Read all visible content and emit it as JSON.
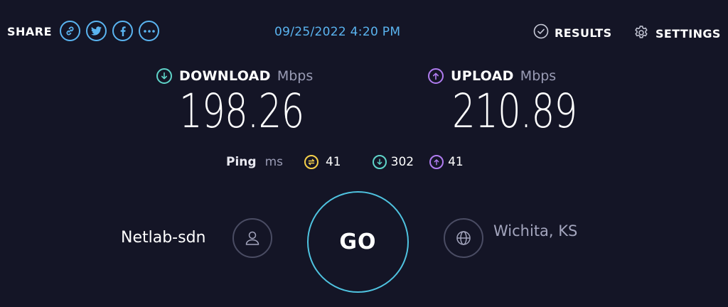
{
  "header": {
    "share_label": "SHARE",
    "share_icons": [
      "link-icon",
      "twitter-icon",
      "facebook-icon",
      "more-icon"
    ],
    "timestamp": "09/25/2022 4:20 PM",
    "results_label": "RESULTS",
    "settings_label": "SETTINGS"
  },
  "download": {
    "label": "DOWNLOAD",
    "unit": "Mbps",
    "value": "198.26",
    "color": "#5fd4c9"
  },
  "upload": {
    "label": "UPLOAD",
    "unit": "Mbps",
    "value": "210.89",
    "color": "#b07cf0"
  },
  "ping": {
    "label": "Ping",
    "unit": "ms",
    "idle": "41",
    "download": "302",
    "upload": "41",
    "idle_color": "#f5d04a"
  },
  "go_label": "GO",
  "host": {
    "name": "Netlab-sdn"
  },
  "server": {
    "location": "Wichita, KS"
  },
  "colors": {
    "background": "#141526",
    "accent": "#5ab4f0",
    "go_ring": "#4fc3e0"
  }
}
